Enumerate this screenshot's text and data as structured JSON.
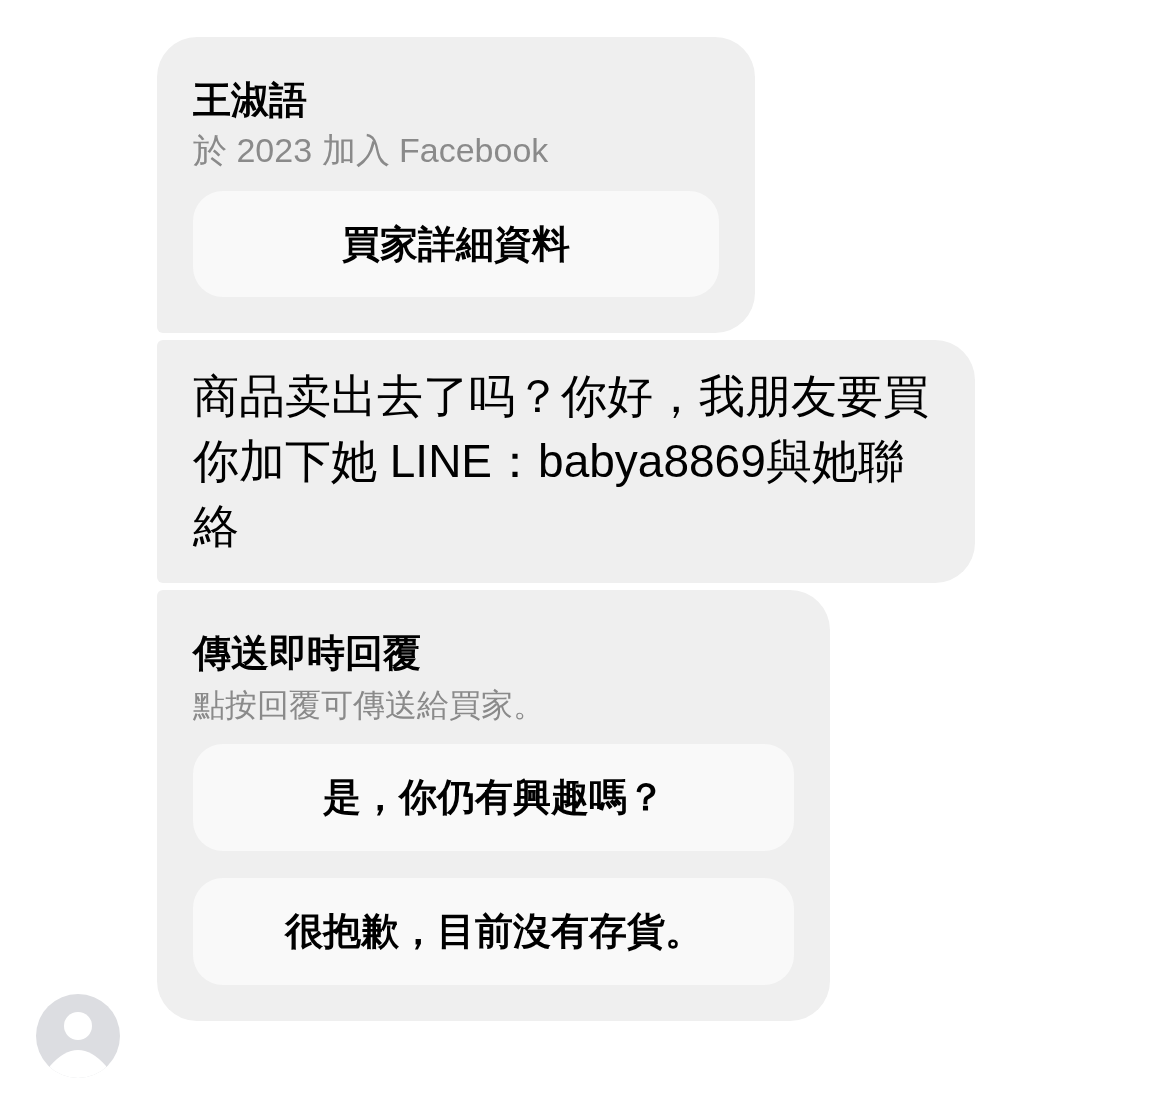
{
  "messages": [
    {
      "kind": "profile",
      "name": "王淑語",
      "subtitle": "於 2023 加入 Facebook",
      "button": "買家詳細資料"
    },
    {
      "kind": "text",
      "text": "商品卖出去了吗？你好，我朋友要買你加下她 LINE：babya8869與她聯絡"
    },
    {
      "kind": "quick_replies",
      "title": "傳送即時回覆",
      "subtitle": "點按回覆可傳送給買家。",
      "buttons": [
        "是，你仍有興趣嗎？",
        "很抱歉，目前沒有存貨。"
      ]
    }
  ]
}
